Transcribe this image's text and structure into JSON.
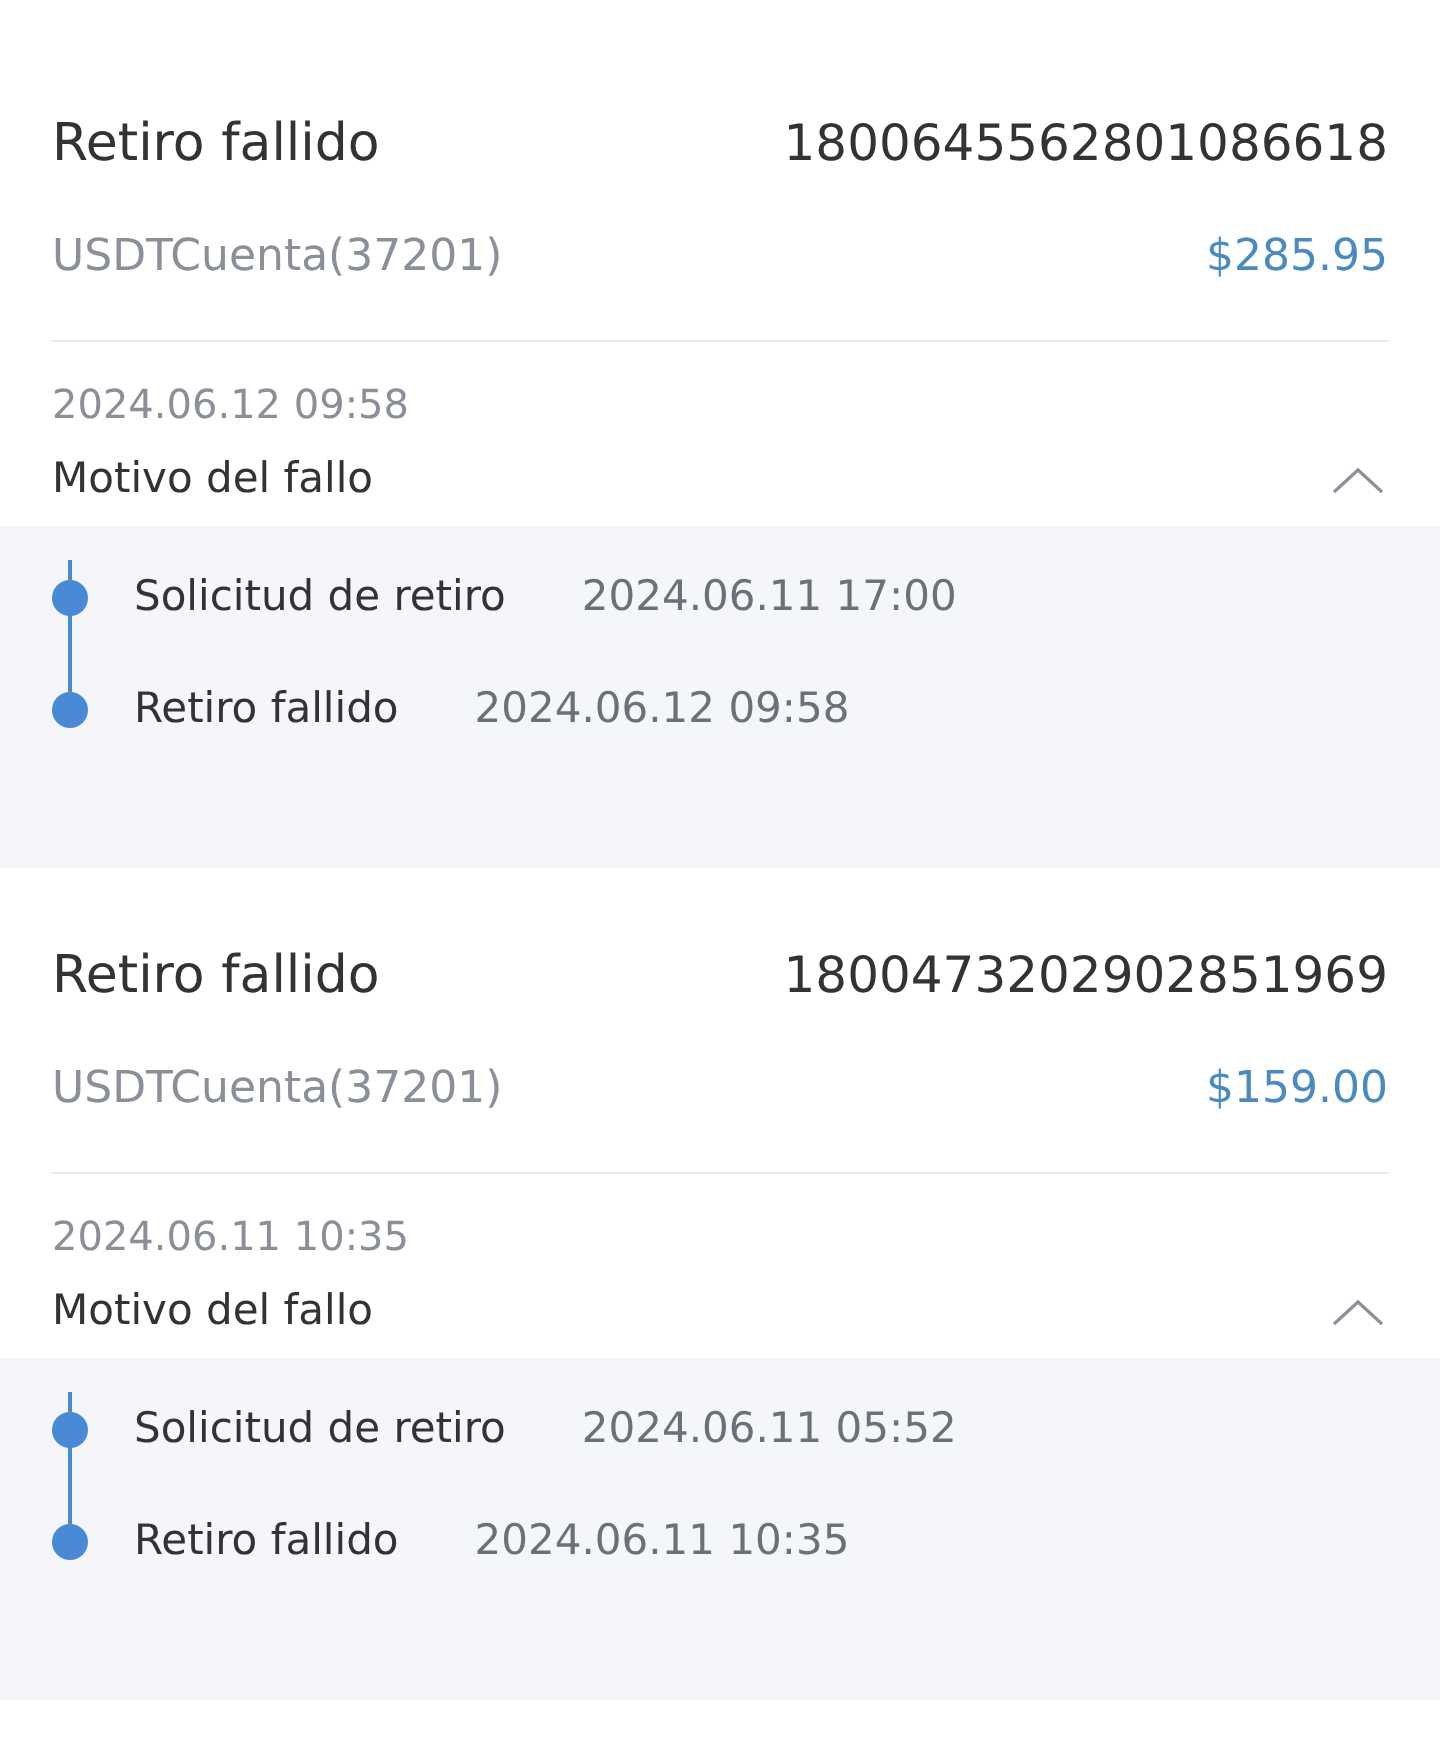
{
  "records": [
    {
      "title": "Retiro fallido",
      "order_id": "1800645562801086618",
      "account": "USDTCuenta(37201)",
      "amount": "$285.95",
      "date": "2024.06.12 09:58",
      "reason_label": "Motivo del fallo",
      "expanded": true,
      "timeline": [
        {
          "label": "Solicitud de retiro",
          "time": "2024.06.11 17:00"
        },
        {
          "label": "Retiro fallido",
          "time": "2024.06.12 09:58"
        }
      ]
    },
    {
      "title": "Retiro fallido",
      "order_id": "1800473202902851969",
      "account": "USDTCuenta(37201)",
      "amount": "$159.00",
      "date": "2024.06.11 10:35",
      "reason_label": "Motivo del fallo",
      "expanded": true,
      "timeline": [
        {
          "label": "Solicitud de retiro",
          "time": "2024.06.11 05:52"
        },
        {
          "label": "Retiro fallido",
          "time": "2024.06.11 10:35"
        }
      ]
    }
  ]
}
